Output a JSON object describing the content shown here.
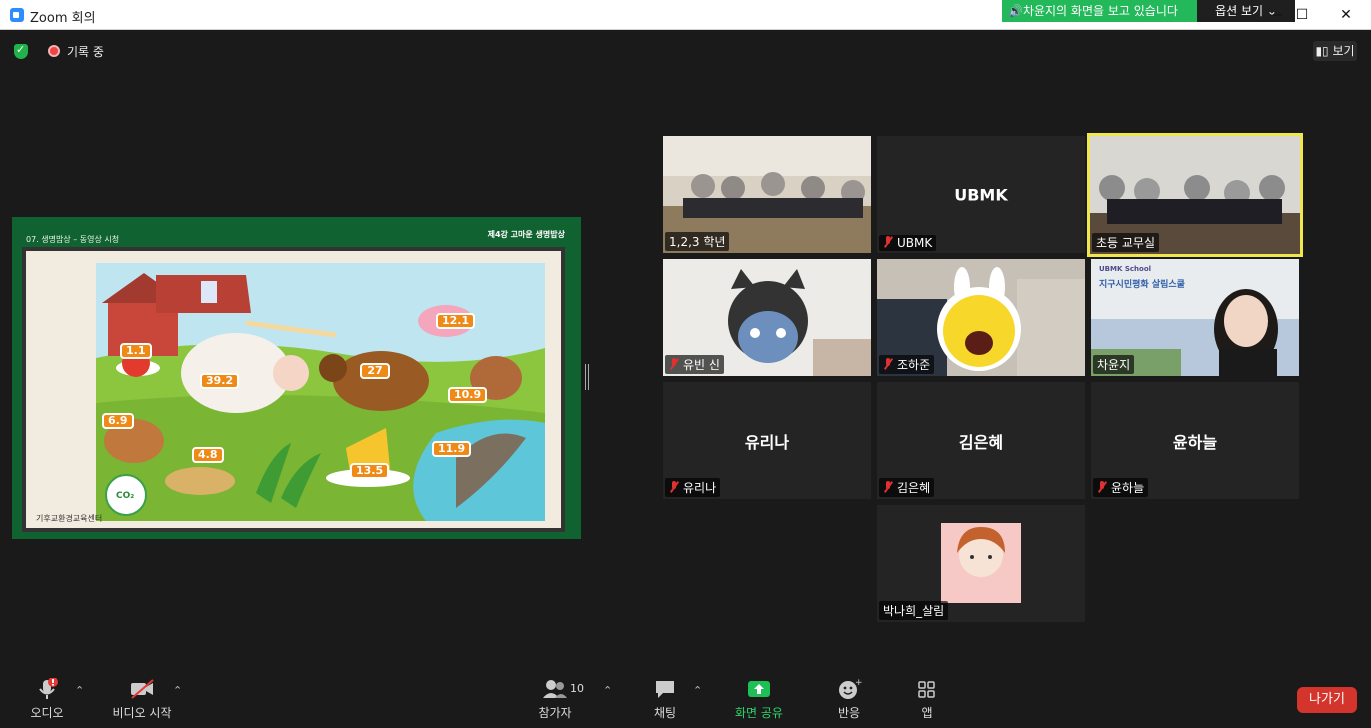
{
  "window": {
    "title": "Zoom 회의"
  },
  "share_banner": {
    "text": "🔊차윤지의 화면을 보고 있습니다",
    "options_label": "옵션 보기 ⌄"
  },
  "window_controls": {
    "minimize": "—",
    "maximize": "☐",
    "close": "✕"
  },
  "header": {
    "recording_label": "기록 중",
    "view_label": "보기"
  },
  "slide": {
    "left_header": "07. 생명밥상 – 동영상 시청",
    "right_header": "제4강 고마운 생명밥상",
    "footer_text": "기후교환경교육센터",
    "co2_badge": "CO₂",
    "values": {
      "tomato": "1.1",
      "sheep": "39.2",
      "cow": "27",
      "pig": "12.1",
      "turkey": "10.9",
      "chicken": "6.9",
      "eggs": "4.8",
      "cheese": "13.5",
      "fish": "11.9"
    }
  },
  "participants": {
    "grade_class": {
      "name": "1,2,3 학년"
    },
    "ubmk": {
      "big_name": "UBMK",
      "name": "UBMK"
    },
    "office": {
      "name": "초등 교무실"
    },
    "yubin": {
      "name": "유빈 신"
    },
    "jo": {
      "name": "조하준"
    },
    "cha": {
      "name": "차윤지",
      "banner_line1": "UBMK School",
      "banner_line2": "지구시민평화 살림스쿨"
    },
    "yurina": {
      "big_name": "유리나",
      "name": "유리나"
    },
    "kim": {
      "big_name": "김은혜",
      "name": "김은혜"
    },
    "yoon": {
      "big_name": "윤하늘",
      "name": "윤하늘"
    },
    "park": {
      "name": "박나희_살림"
    }
  },
  "toolbar": {
    "audio": "오디오",
    "video": "비디오 시작",
    "participants": "참가자",
    "participants_count": "10",
    "chat": "채팅",
    "share": "화면 공유",
    "reactions": "반응",
    "apps": "앱",
    "leave": "나가기",
    "caret": "⌃"
  }
}
